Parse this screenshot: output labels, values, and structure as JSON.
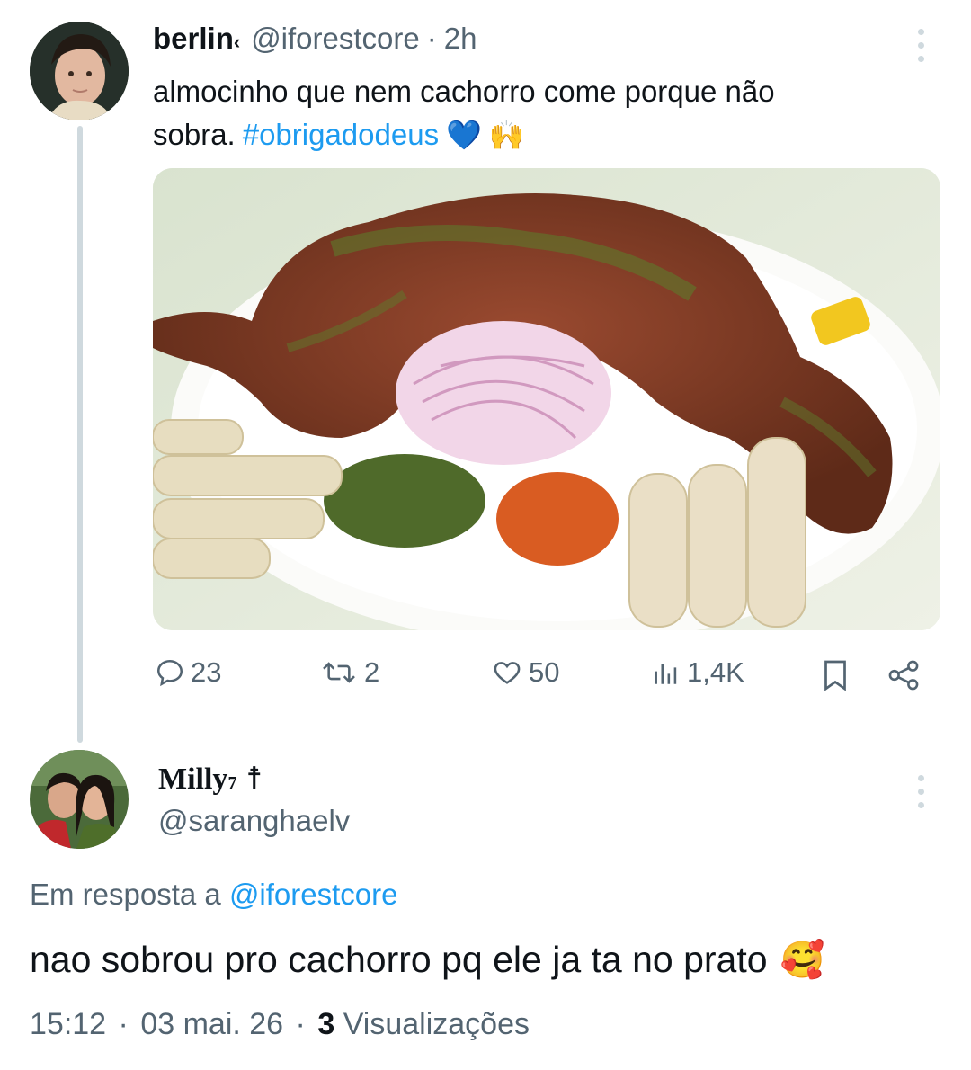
{
  "original_tweet": {
    "display_name": "berlin",
    "name_suffix": "‹",
    "handle": "@iforestcore",
    "separator": "·",
    "time": "2h",
    "text_line1": "almocinho que nem cachorro come porque não",
    "text_line2": "sobra.",
    "hashtag": "#obrigadodeus",
    "emojis": [
      "💙",
      "🙌"
    ],
    "actions": {
      "replies": "23",
      "reposts": "2",
      "likes": "50",
      "views": "1,4K"
    }
  },
  "reply": {
    "display_name": "Milly",
    "superscript": "7",
    "name_symbol": "☨",
    "handle": "@saranghaelv",
    "reply_to_prefix": "Em resposta a",
    "reply_to_handle": "@iforestcore",
    "text": "nao sobrou pro cachorro pq ele ja ta no prato",
    "emoji": "🥰",
    "time": "15:12",
    "date": "03 mai. 26",
    "separator": "·",
    "views_count": "3",
    "views_label": "Visualizações"
  },
  "colors": {
    "text": "#0f1419",
    "muted": "#536471",
    "link": "#1d9bf0",
    "line": "#cfd9de"
  }
}
